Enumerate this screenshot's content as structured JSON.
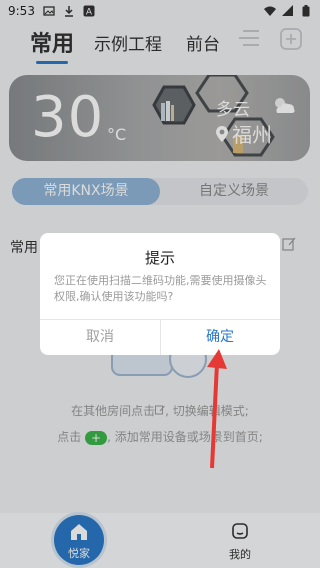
{
  "status_bar": {
    "time": "9:53",
    "left_icons": [
      "image-icon",
      "download-icon",
      "a-app-icon"
    ],
    "right_icons": [
      "wifi-icon",
      "signal-icon",
      "battery-icon"
    ]
  },
  "top_tabs": [
    {
      "label": "常用",
      "active": true
    },
    {
      "label": "示例工程",
      "active": false
    },
    {
      "label": "前台",
      "active": false
    }
  ],
  "top_icons": [
    "menu-icon",
    "add-icon"
  ],
  "weather": {
    "temperature": "30",
    "unit": "°C",
    "condition": "多云",
    "city": "福州"
  },
  "scene_tabs": [
    {
      "label": "常用KNX场景",
      "active": true
    },
    {
      "label": "自定义场景",
      "active": false
    }
  ],
  "section": {
    "label": "常用"
  },
  "hints": {
    "line1": "在其他房间点击",
    "line1_suffix": ", 切换编辑模式;",
    "line2_prefix": "点击",
    "line2_suffix": ", 添加常用设备或场景到首页;"
  },
  "dialog": {
    "title": "提示",
    "message": "您正在使用扫描二维码功能,需要使用摄像头权限,确认使用该功能吗?",
    "cancel": "取消",
    "confirm": "确定"
  },
  "bottom_nav": [
    {
      "label": "悦家",
      "active": true
    },
    {
      "label": "我的",
      "active": false
    }
  ],
  "colors": {
    "accent": "#2a78c7",
    "arrow": "#e53935",
    "plus_chip": "#3bb54a"
  }
}
